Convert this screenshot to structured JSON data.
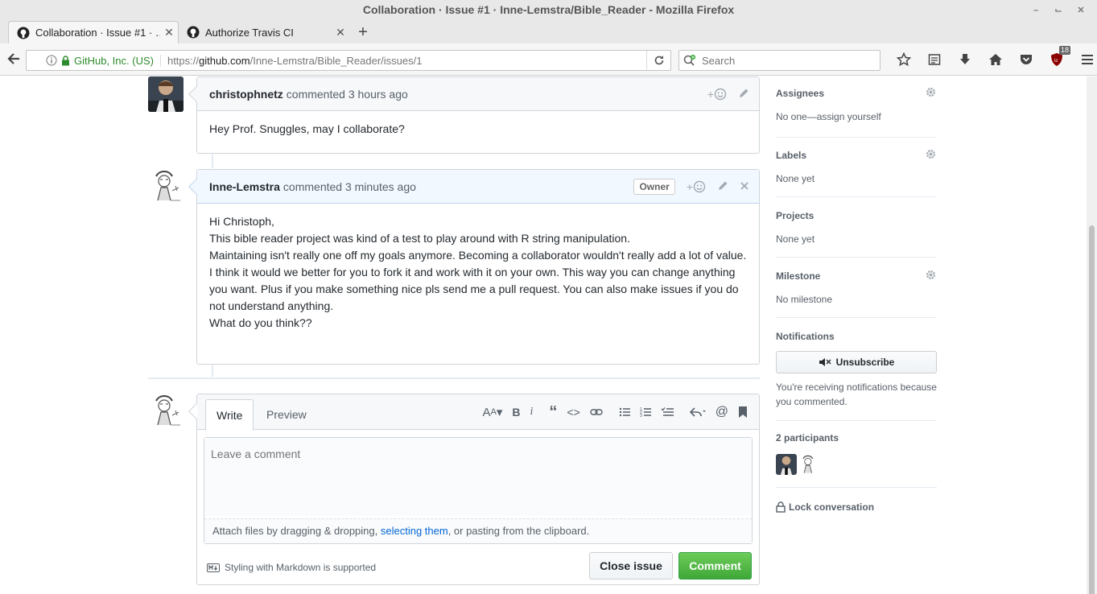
{
  "window": {
    "title": "Collaboration · Issue #1 · Inne-Lemstra/Bible_Reader - Mozilla Firefox"
  },
  "tabs": [
    {
      "label": "Collaboration · Issue #1 · …",
      "active": true
    },
    {
      "label": "Authorize Travis CI",
      "active": false
    }
  ],
  "urlbar": {
    "identity": "GitHub, Inc. (US)",
    "url_prefix": "https://",
    "url_domain": "github.com",
    "url_path": "/Inne-Lemstra/Bible_Reader/issues/1"
  },
  "search": {
    "placeholder": "Search"
  },
  "toolbar": {
    "ublock_count": "18"
  },
  "comments": [
    {
      "author": "christophnetz",
      "meta": "commented 3 hours ago",
      "body": [
        "Hey Prof. Snuggles, may I collaborate?"
      ]
    },
    {
      "author": "Inne-Lemstra",
      "meta": "commented 3 minutes ago",
      "badge": "Owner",
      "body": [
        "Hi Christoph,",
        "This bible reader project was kind of a test to play around with R string manipulation.",
        "Maintaining isn't really one off my goals anymore. Becoming a collaborator wouldn't really add a lot of value.",
        "I think it would we better for you to fork it and work with it on your own. This way you can change anything you want. Plus if you make something nice pls send me a pull request. You can also make issues if you do not understand anything.",
        "What do you think??"
      ]
    }
  ],
  "composer": {
    "tab_write": "Write",
    "tab_preview": "Preview",
    "placeholder": "Leave a comment",
    "attach_prefix": "Attach files by dragging & dropping, ",
    "attach_link": "selecting them",
    "attach_suffix": ", or pasting from the clipboard.",
    "markdown_note": "Styling with Markdown is supported",
    "close_button": "Close issue",
    "comment_button": "Comment"
  },
  "sidebar": {
    "assignees": {
      "title": "Assignees",
      "value": "No one—assign yourself"
    },
    "labels": {
      "title": "Labels",
      "value": "None yet"
    },
    "projects": {
      "title": "Projects",
      "value": "None yet"
    },
    "milestone": {
      "title": "Milestone",
      "value": "No milestone"
    },
    "notifications": {
      "title": "Notifications",
      "button": "Unsubscribe",
      "note": "You're receiving notifications because you commented."
    },
    "participants": {
      "title": "2 participants"
    },
    "lock": "Lock conversation"
  }
}
